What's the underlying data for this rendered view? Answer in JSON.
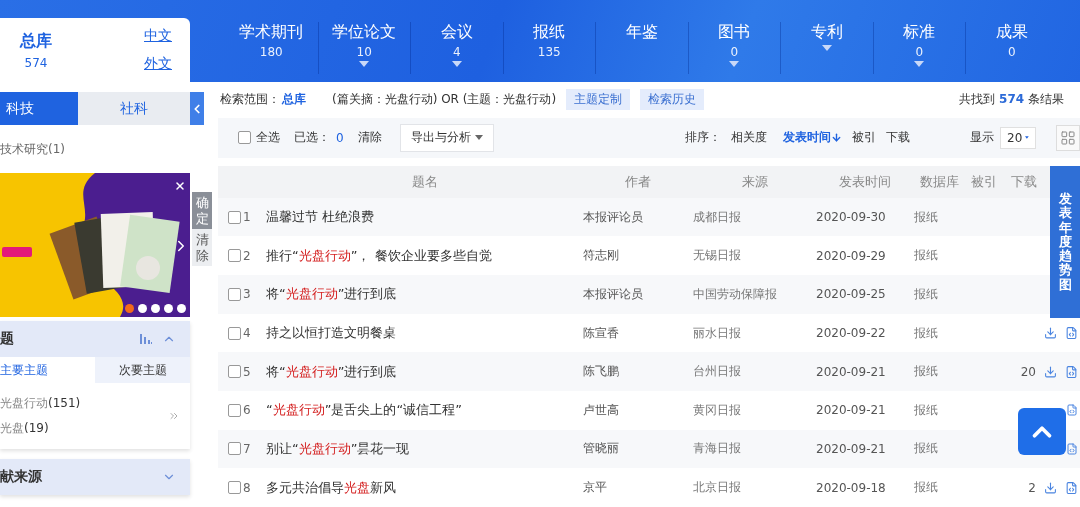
{
  "left_panel": {
    "library": {
      "title": "总库",
      "count": "574"
    },
    "language_links": [
      "中文",
      "外文"
    ],
    "tabs": [
      {
        "label": "科技",
        "selected": true
      },
      {
        "label": "社科",
        "selected": false
      }
    ],
    "subject_items": [
      "技术研究(1)"
    ],
    "banner": {
      "kind": "picture",
      "dots": [
        {
          "selected": true
        },
        {
          "selected": false
        },
        {
          "selected": false
        },
        {
          "selected": false
        },
        {
          "selected": false
        }
      ]
    },
    "side_buttons": [
      "确定",
      "清除"
    ],
    "topic_section": {
      "title": "题",
      "expanded": true,
      "tabs": [
        {
          "label": "主要主题",
          "selected": true
        },
        {
          "label": "次要主题",
          "selected": false
        }
      ],
      "items": [
        "光盘行动**(151)**",
        "光盘**(19)**"
      ]
    },
    "source_section": {
      "title": "献来源",
      "expanded": false
    }
  },
  "nav_tabs": [
    {
      "label": "学术期刊",
      "count": "180",
      "dropdown": false
    },
    {
      "label": "学位论文",
      "count": "10",
      "dropdown": true
    },
    {
      "label": "会议",
      "count": "4",
      "dropdown": true
    },
    {
      "label": "报纸",
      "count": "135",
      "dropdown": false
    },
    {
      "label": "年鉴",
      "dropdown": false
    },
    {
      "label": "图书",
      "count": "0",
      "dropdown": true
    },
    {
      "label": "专利",
      "dropdown": true
    },
    {
      "label": "标准",
      "count": "0",
      "dropdown": true
    },
    {
      "label": "成果",
      "count": "0",
      "dropdown": false
    }
  ],
  "search_info": {
    "scope_label": "检索范围：",
    "scope": "总库",
    "query": "(篇关摘：光盘行动) OR (主题：光盘行动)",
    "buttons": [
      "主题定制",
      "检索历史"
    ],
    "summary": "共找到 **574** 条结果"
  },
  "toolbar": {
    "select_all": {
      "label": "全选",
      "checked": false
    },
    "selected_label": "已选：",
    "selected_count": "0",
    "clear": "清除",
    "export": "导出与分析",
    "sort_label": "排序：",
    "sort_options": [
      {
        "label": "相关度",
        "selected": false
      },
      {
        "label": "发表时间",
        "selected": true
      },
      {
        "label": "被引",
        "selected": false
      },
      {
        "label": "下载",
        "selected": false
      }
    ],
    "page_size_label": "显示",
    "page_size": "20"
  },
  "table": {
    "columns": [
      "题名",
      "作者",
      "来源",
      "发表时间",
      "数据库",
      "被引",
      "下载"
    ],
    "rows": [
      {
        "number": "1",
        "selected": false,
        "title": [
          {
            "text": "温馨过节 杜绝浪费",
            "highlight": false
          }
        ],
        "author": "本报评论员",
        "source": "成都日报",
        "date": "2020-09-30",
        "database": "报纸",
        "download_icon": false,
        "file_icon": false
      },
      {
        "number": "2",
        "selected": false,
        "title": [
          {
            "text": "推行“",
            "highlight": false
          },
          {
            "text": "光盘行动",
            "highlight": true
          },
          {
            "text": "”， 餐饮企业要多些自觉",
            "highlight": false
          }
        ],
        "author": "符志刚",
        "source": "无锡日报",
        "date": "2020-09-29",
        "database": "报纸",
        "download_icon": false,
        "file_icon": false
      },
      {
        "number": "3",
        "selected": false,
        "title": [
          {
            "text": "将“",
            "highlight": false
          },
          {
            "text": "光盘行动",
            "highlight": true
          },
          {
            "text": "”进行到底",
            "highlight": false
          }
        ],
        "author": "本报评论员",
        "source": "中国劳动保障报",
        "date": "2020-09-25",
        "database": "报纸",
        "download_icon": false,
        "file_icon": false
      },
      {
        "number": "4",
        "selected": false,
        "title": [
          {
            "text": "持之以恒打造文明餐桌",
            "highlight": false
          }
        ],
        "author": "陈宣香",
        "source": "丽水日报",
        "date": "2020-09-22",
        "database": "报纸",
        "download_icon": true,
        "file_icon": true
      },
      {
        "number": "5",
        "selected": false,
        "title": [
          {
            "text": "将“",
            "highlight": false
          },
          {
            "text": "光盘行动",
            "highlight": true
          },
          {
            "text": "”进行到底",
            "highlight": false
          }
        ],
        "author": "陈飞鹏",
        "source": "台州日报",
        "date": "2020-09-21",
        "database": "报纸",
        "downloads": "20",
        "download_icon": true,
        "file_icon": true
      },
      {
        "number": "6",
        "selected": false,
        "title": [
          {
            "text": "“",
            "highlight": false
          },
          {
            "text": "光盘行动",
            "highlight": true
          },
          {
            "text": "”是舌尖上的“诚信工程”",
            "highlight": false
          }
        ],
        "author": "卢世高",
        "source": "黄冈日报",
        "date": "2020-09-21",
        "database": "报纸",
        "download_icon": false,
        "file_icon": true
      },
      {
        "number": "7",
        "selected": false,
        "title": [
          {
            "text": "别让“",
            "highlight": false
          },
          {
            "text": "光盘行动",
            "highlight": true
          },
          {
            "text": "”昙花一现",
            "highlight": false
          }
        ],
        "author": "管晓丽",
        "source": "青海日报",
        "date": "2020-09-21",
        "database": "报纸",
        "download_icon": false,
        "file_icon": true
      },
      {
        "number": "8",
        "selected": false,
        "title": [
          {
            "text": "多元共治倡导",
            "highlight": false
          },
          {
            "text": "光盘",
            "highlight": true
          },
          {
            "text": "新风",
            "highlight": false
          }
        ],
        "author": "京平",
        "source": "北京日报",
        "date": "2020-09-18",
        "database": "报纸",
        "downloads": "2",
        "download_icon": true,
        "file_icon": true
      }
    ]
  },
  "trend_tab": "发表年度趋势图"
}
